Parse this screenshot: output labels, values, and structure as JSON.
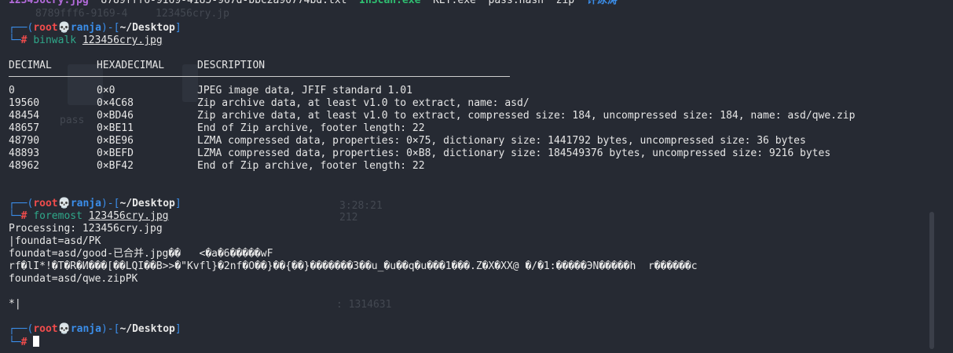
{
  "top_listing": {
    "f1": "123456cry.jpg",
    "f2": "8789fff6-9169-4185-967d-bbc2a90774bd.txt",
    "f3": "InScan.exe",
    "f4": "KEY.exe",
    "f5": "pass.hash",
    "f6": "zip",
    "f7": "许泳涛"
  },
  "ghost": {
    "g1": "8789fff6-9169-4",
    "g2": "123456cry.jp",
    "g3": "pass",
    "g4": "3:28:21",
    "g5": "212",
    "g6": ": 1314631"
  },
  "prompt": {
    "user": "root",
    "skull": "💀",
    "host": "ranja",
    "path": "~/Desktop",
    "hash": "#"
  },
  "cmd1": {
    "name": "binwalk",
    "arg": "123456cry.jpg"
  },
  "binwalk": {
    "headers": [
      "DECIMAL",
      "HEXADECIMAL",
      "DESCRIPTION"
    ],
    "rows": [
      [
        "0",
        "0×0",
        "JPEG image data, JFIF standard 1.01"
      ],
      [
        "19560",
        "0×4C68",
        "Zip archive data, at least v1.0 to extract, name: asd/"
      ],
      [
        "48454",
        "0×BD46",
        "Zip archive data, at least v1.0 to extract, compressed size: 184, uncompressed size: 184, name: asd/qwe.zip"
      ],
      [
        "48657",
        "0×BE11",
        "End of Zip archive, footer length: 22"
      ],
      [
        "48790",
        "0×BE96",
        "LZMA compressed data, properties: 0×75, dictionary size: 1441792 bytes, uncompressed size: 36 bytes"
      ],
      [
        "48893",
        "0×BEFD",
        "LZMA compressed data, properties: 0×B8, dictionary size: 184549376 bytes, uncompressed size: 9216 bytes"
      ],
      [
        "48962",
        "0×BF42",
        "End of Zip archive, footer length: 22"
      ]
    ]
  },
  "cmd2": {
    "name": "foremost",
    "arg": "123456cry.jpg"
  },
  "foremost": {
    "l1": "Processing: 123456cry.jpg",
    "l2": "|foundat=asd/PK",
    "l3": "foundat=asd/good-已合并.jpg��   <�a�6�����wF",
    "l4": "rf�lI*!�T�R�И���[��LQI��B>>�\"Kvfl}�2nf�O��}��{��}�������3��u_�u��q�u���1���.Z�X�XX@ �/�1:�����ЭN�����h  r������c",
    "l5": "foundat=asd/qwe.zipPK",
    "l6": "*|"
  }
}
